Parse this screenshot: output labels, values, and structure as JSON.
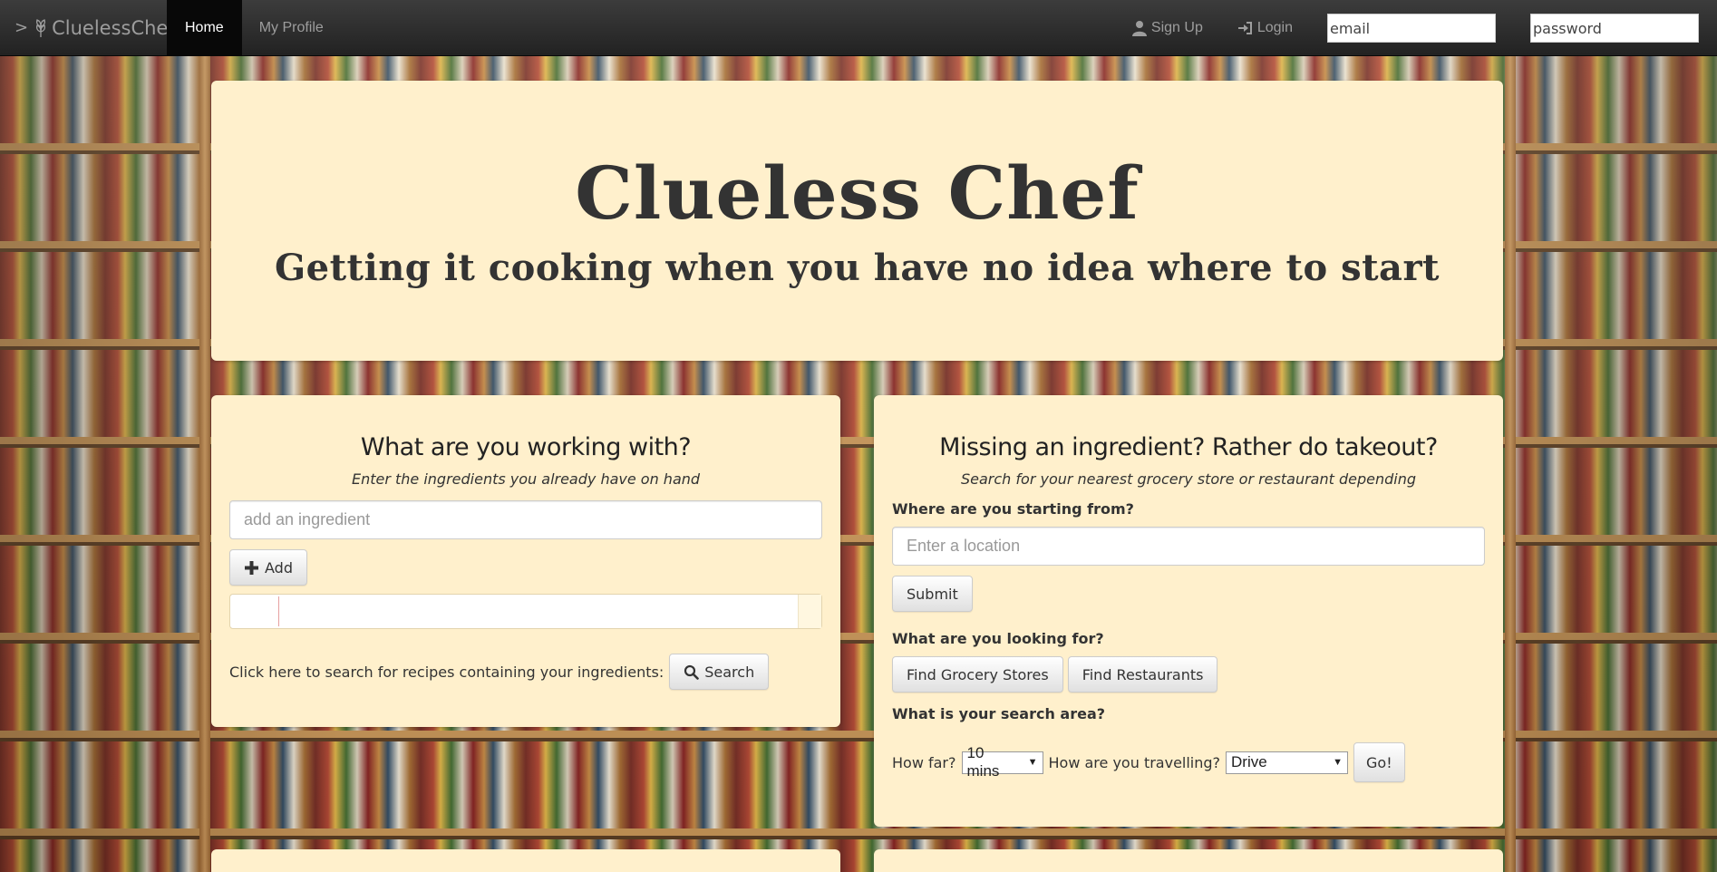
{
  "navbar": {
    "brand_caret": ">",
    "brand_name": "CluelessChef",
    "brand_icon": "leaf-icon",
    "items": [
      {
        "label": "Home",
        "active": true
      },
      {
        "label": "My Profile",
        "active": false
      }
    ],
    "signup_label": "Sign Up",
    "login_label": "Login",
    "email_placeholder": "email",
    "password_placeholder": "password"
  },
  "hero": {
    "title": "Clueless Chef",
    "subtitle": "Getting it cooking when you have no idea where to start"
  },
  "ingredients_panel": {
    "title": "What are you working with?",
    "subtitle": "Enter the ingredients you already have on hand",
    "input_placeholder": "add an ingredient",
    "add_label": "Add",
    "search_prompt": "Click here to search for recipes containing your ingredients:",
    "search_label": "Search"
  },
  "locate_panel": {
    "title": "Missing an ingredient? Rather do takeout?",
    "subtitle": "Search for your nearest grocery store or restaurant depending",
    "start_label": "Where are you starting from?",
    "location_placeholder": "Enter a location",
    "submit_label": "Submit",
    "looking_label": "What are you looking for?",
    "grocery_label": "Find Grocery Stores",
    "restaurants_label": "Find Restaurants",
    "area_label": "What is your search area?",
    "how_far_label": "How far?",
    "how_far_value": "10 mins",
    "travel_label": "How are you travelling?",
    "travel_value": "Drive",
    "go_label": "Go!"
  },
  "colors": {
    "navbar": "#222222",
    "panel": "#fff0cc",
    "text": "#333333"
  }
}
